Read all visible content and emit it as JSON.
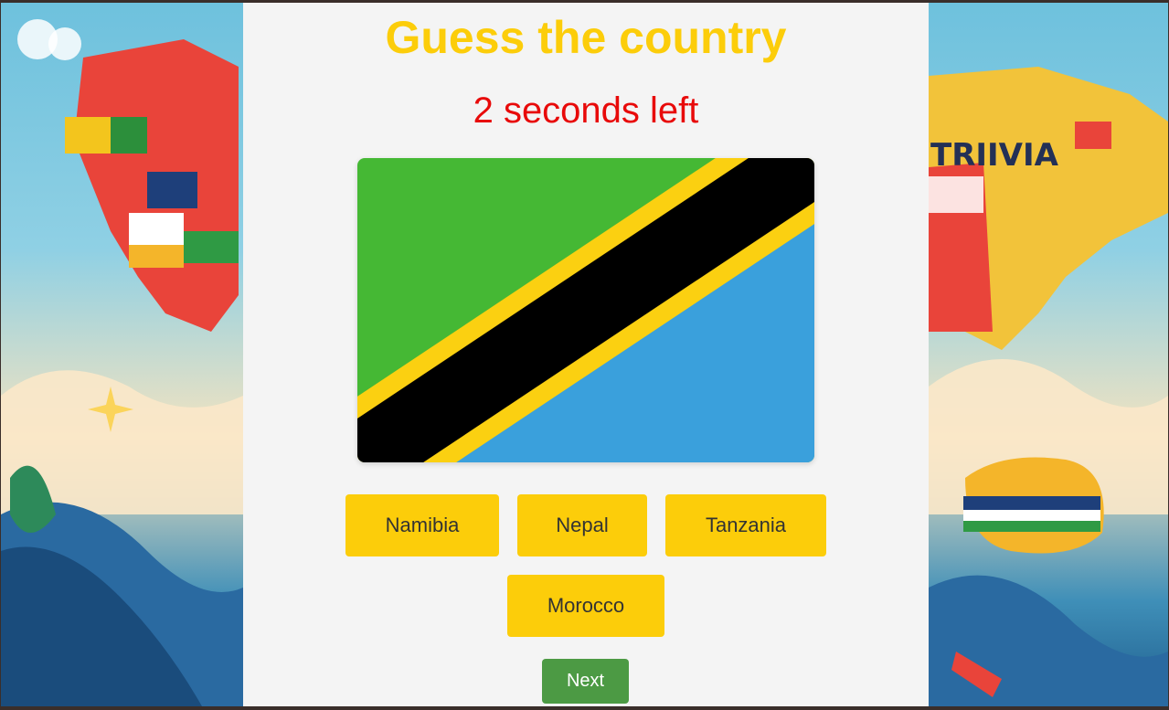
{
  "page": {
    "title": "Guess the country",
    "timer_text": "2 seconds left"
  },
  "flag": {
    "icon": "tanzania-flag",
    "colors": {
      "green": "#45b834",
      "yellow": "#fbd011",
      "black": "#000000",
      "blue": "#3aa0dc"
    }
  },
  "answers": [
    {
      "label": "Namibia"
    },
    {
      "label": "Nepal"
    },
    {
      "label": "Tanzania"
    },
    {
      "label": "Morocco"
    }
  ],
  "next_button": {
    "label": "Next"
  },
  "background": {
    "right_banner_text": "TRIIVIA"
  },
  "colors": {
    "title": "#fccd0a",
    "timer": "#e80a0a",
    "answer_button": "#fccd0a",
    "next_button": "#4c9a44",
    "panel": "#f4f4f4"
  }
}
